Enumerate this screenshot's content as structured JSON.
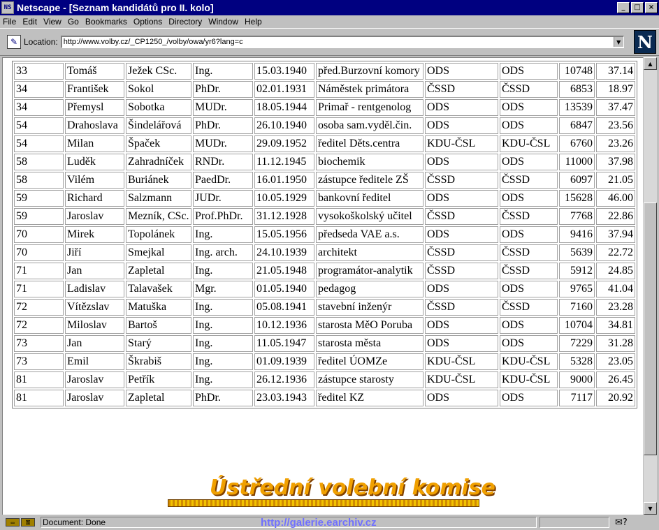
{
  "window": {
    "title": "Netscape - [Seznam kandidátů pro II. kolo]",
    "buttons": {
      "minimize": "_",
      "maximize": "□",
      "close": "×"
    }
  },
  "menu": [
    "File",
    "Edit",
    "View",
    "Go",
    "Bookmarks",
    "Options",
    "Directory",
    "Window",
    "Help"
  ],
  "location": {
    "label": "Location:",
    "url": "http://www.volby.cz/_CP1250_/volby/owa/yr6?lang=c"
  },
  "logo": "N",
  "candidates": [
    [
      "33",
      "Tomáš",
      "Ježek CSc.",
      "Ing.",
      "15.03.1940",
      "před.Burzovní komory",
      "ODS",
      "ODS",
      "10748",
      "37.14"
    ],
    [
      "34",
      "František",
      "Sokol",
      "PhDr.",
      "02.01.1931",
      "Náměstek primátora",
      "ČSSD",
      "ČSSD",
      "6853",
      "18.97"
    ],
    [
      "34",
      "Přemysl",
      "Sobotka",
      "MUDr.",
      "18.05.1944",
      "Primař - rentgenolog",
      "ODS",
      "ODS",
      "13539",
      "37.47"
    ],
    [
      "54",
      "Drahoslava",
      "Šindelářová",
      "PhDr.",
      "26.10.1940",
      "osoba sam.vyděl.čin.",
      "ODS",
      "ODS",
      "6847",
      "23.56"
    ],
    [
      "54",
      "Milan",
      "Špaček",
      "MUDr.",
      "29.09.1952",
      "ředitel Děts.centra",
      "KDU-ČSL",
      "KDU-ČSL",
      "6760",
      "23.26"
    ],
    [
      "58",
      "Luděk",
      "Zahradníček",
      "RNDr.",
      "11.12.1945",
      "biochemik",
      "ODS",
      "ODS",
      "11000",
      "37.98"
    ],
    [
      "58",
      "Vilém",
      "Buriánek",
      "PaedDr.",
      "16.01.1950",
      "zástupce ředitele ZŠ",
      "ČSSD",
      "ČSSD",
      "6097",
      "21.05"
    ],
    [
      "59",
      "Richard",
      "Salzmann",
      "JUDr.",
      "10.05.1929",
      "bankovní ředitel",
      "ODS",
      "ODS",
      "15628",
      "46.00"
    ],
    [
      "59",
      "Jaroslav",
      "Mezník, CSc.",
      "Prof.PhDr.",
      "31.12.1928",
      "vysokoškolský učitel",
      "ČSSD",
      "ČSSD",
      "7768",
      "22.86"
    ],
    [
      "70",
      "Mirek",
      "Topolánek",
      "Ing.",
      "15.05.1956",
      "předseda VAE a.s.",
      "ODS",
      "ODS",
      "9416",
      "37.94"
    ],
    [
      "70",
      "Jiří",
      "Smejkal",
      "Ing. arch.",
      "24.10.1939",
      "architekt",
      "ČSSD",
      "ČSSD",
      "5639",
      "22.72"
    ],
    [
      "71",
      "Jan",
      "Zapletal",
      "Ing.",
      "21.05.1948",
      "programátor-analytik",
      "ČSSD",
      "ČSSD",
      "5912",
      "24.85"
    ],
    [
      "71",
      "Ladislav",
      "Talavašek",
      "Mgr.",
      "01.05.1940",
      "pedagog",
      "ODS",
      "ODS",
      "9765",
      "41.04"
    ],
    [
      "72",
      "Vítězslav",
      "Matuška",
      "Ing.",
      "05.08.1941",
      "stavební inženýr",
      "ČSSD",
      "ČSSD",
      "7160",
      "23.28"
    ],
    [
      "72",
      "Miloslav",
      "Bartoš",
      "Ing.",
      "10.12.1936",
      "starosta MěO Poruba",
      "ODS",
      "ODS",
      "10704",
      "34.81"
    ],
    [
      "73",
      "Jan",
      "Starý",
      "Ing.",
      "11.05.1947",
      "starosta města",
      "ODS",
      "ODS",
      "7229",
      "31.28"
    ],
    [
      "73",
      "Emil",
      "Škrabiš",
      "Ing.",
      "01.09.1939",
      "ředitel ÚOMZe",
      "KDU-ČSL",
      "KDU-ČSL",
      "5328",
      "23.05"
    ],
    [
      "81",
      "Jaroslav",
      "Petřík",
      "Ing.",
      "26.12.1936",
      "zástupce starosty",
      "KDU-ČSL",
      "KDU-ČSL",
      "9000",
      "26.45"
    ],
    [
      "81",
      "Jaroslav",
      "Zapletal",
      "PhDr.",
      "23.03.1943",
      "ředitel KZ",
      "ODS",
      "ODS",
      "7117",
      "20.92"
    ]
  ],
  "banner": "Ústřední volební komise",
  "status": {
    "text": "Document: Done",
    "url": "http://galerie.earchiv.cz"
  },
  "colors": {
    "titlebar": "#000080",
    "chrome": "#c0c0c0",
    "banner": "#f0a000"
  }
}
